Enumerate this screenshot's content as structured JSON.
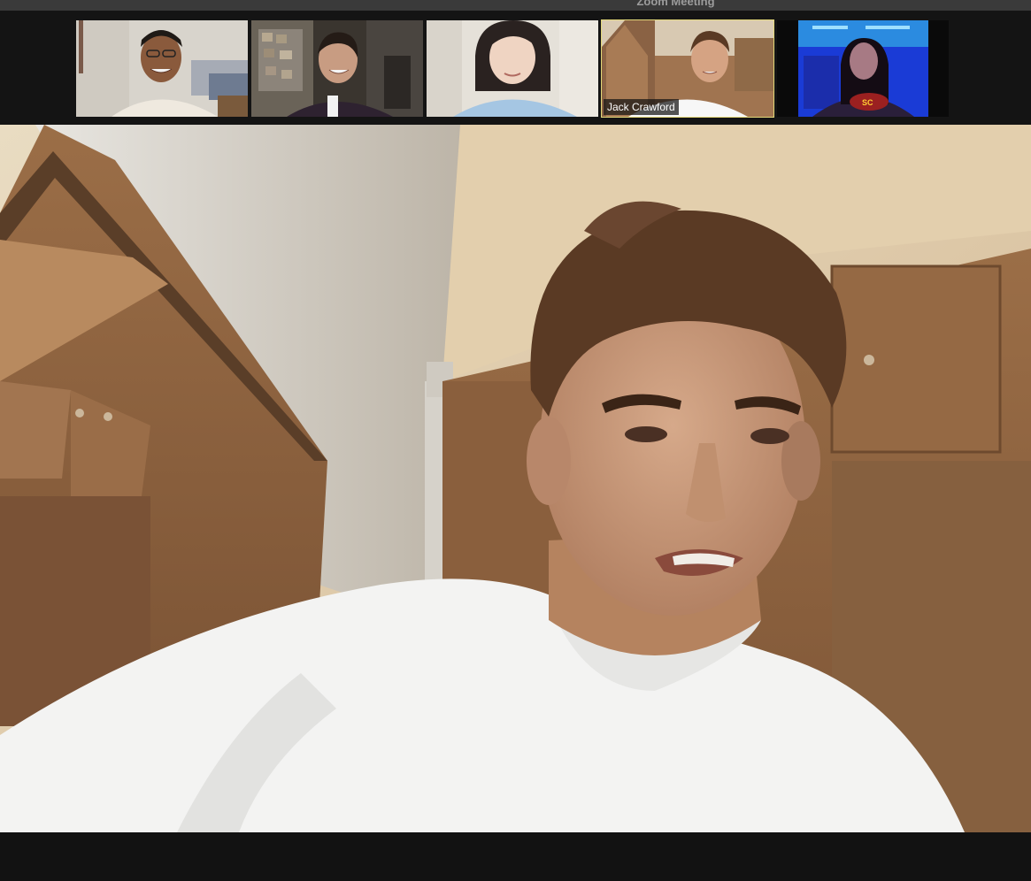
{
  "window": {
    "title": "Zoom Meeting"
  },
  "gallery": {
    "participants": [
      {
        "index": 1,
        "name": "",
        "active_speaker": false
      },
      {
        "index": 2,
        "name": "",
        "active_speaker": false
      },
      {
        "index": 3,
        "name": "",
        "active_speaker": false
      },
      {
        "index": 4,
        "name": "Jack Crawford",
        "active_speaker": true
      },
      {
        "index": 5,
        "name": "",
        "active_speaker": false
      }
    ]
  },
  "colors": {
    "active_speaker_border": "#e3d879",
    "background": "#121212",
    "titlebar": "#3a3a3a"
  }
}
